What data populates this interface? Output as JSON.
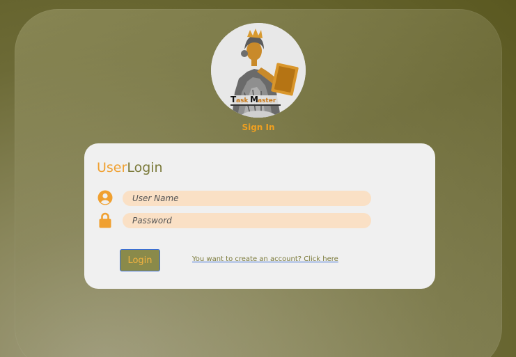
{
  "header": {
    "caption": "Sign In",
    "logo": {
      "icon": "taskmaster-logo-icon",
      "wordmark": "TaskMaster"
    }
  },
  "login_form": {
    "title_part1": "User",
    "title_part2": "Login",
    "username": {
      "placeholder": "User Name",
      "value": "",
      "icon": "user-circle-icon"
    },
    "password": {
      "placeholder": "Password",
      "value": "",
      "icon": "lock-icon"
    },
    "submit_label": "Login",
    "create_account_text": "You want to create an account? Click here"
  },
  "colors": {
    "accent_orange": "#f0a030",
    "olive": "#7b7a3a",
    "input_bg": "#fae0c5",
    "card_bg": "#f0f0f0",
    "button_bg": "#8a8a4a",
    "link_underline": "#3b6fd4"
  }
}
